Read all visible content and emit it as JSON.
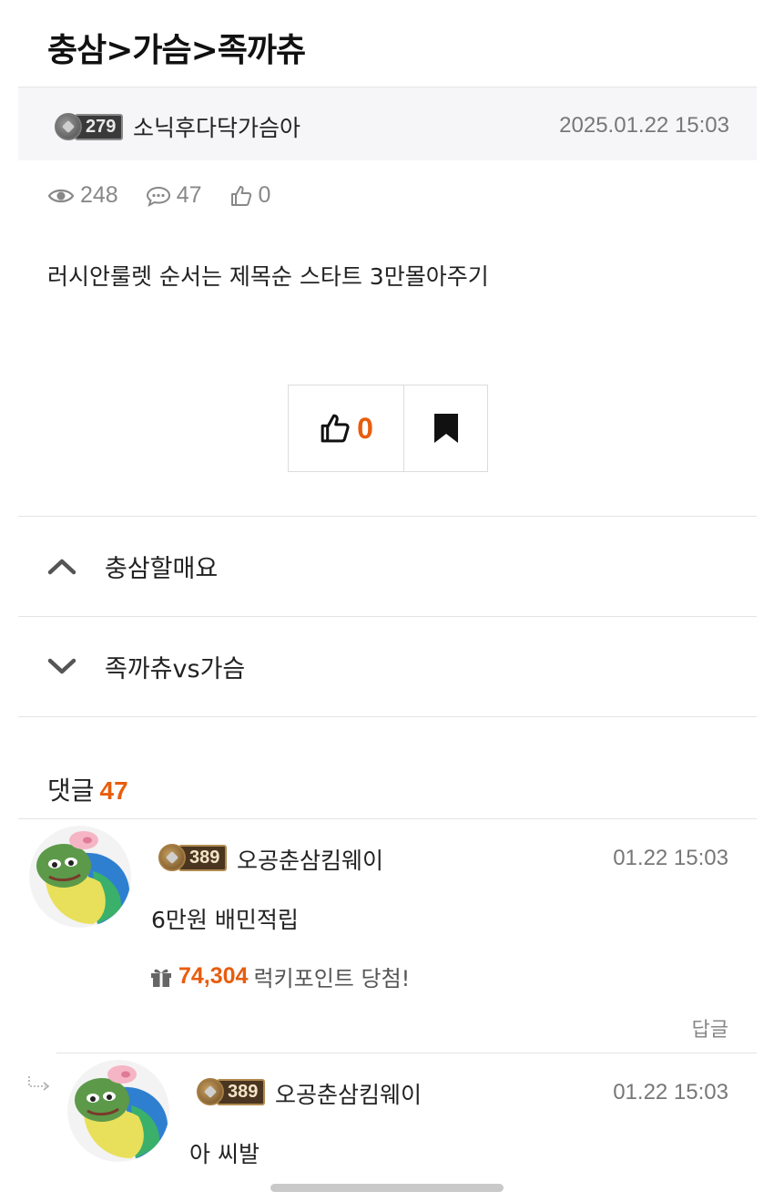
{
  "post": {
    "title": "충삼>가슴>족까츄",
    "author": {
      "level": "279",
      "name": "소닉후다닥가슴아"
    },
    "date": "2025.01.22 15:03",
    "stats": {
      "views": "248",
      "comments": "47",
      "likes": "0"
    },
    "body": "러시안룰렛 순서는 제목순 스타트 3만몰아주기"
  },
  "actions": {
    "like_count": "0"
  },
  "nav": {
    "prev_title": "충삼할매요",
    "next_title": "족까츄vs가슴"
  },
  "comments_section": {
    "label": "댓글",
    "count": "47"
  },
  "comments": [
    {
      "level": "389",
      "author": "오공춘삼킴웨이",
      "date": "01.22 15:03",
      "text": "6만원 배민적립",
      "lucky_amount": "74,304",
      "lucky_text": "럭키포인트 당첨!",
      "reply_label": "답글"
    },
    {
      "level": "389",
      "author": "오공춘삼킴웨이",
      "date": "01.22 15:03",
      "text": "아 씨발"
    }
  ],
  "colors": {
    "accent": "#e85d0c",
    "muted": "#888888",
    "divider": "#e4e4e4"
  },
  "icons": [
    "eye-icon",
    "comment-bubble-icon",
    "thumbs-up-icon",
    "bookmark-icon",
    "chevron-up-icon",
    "chevron-down-icon",
    "gift-icon",
    "reply-arrow-icon"
  ]
}
